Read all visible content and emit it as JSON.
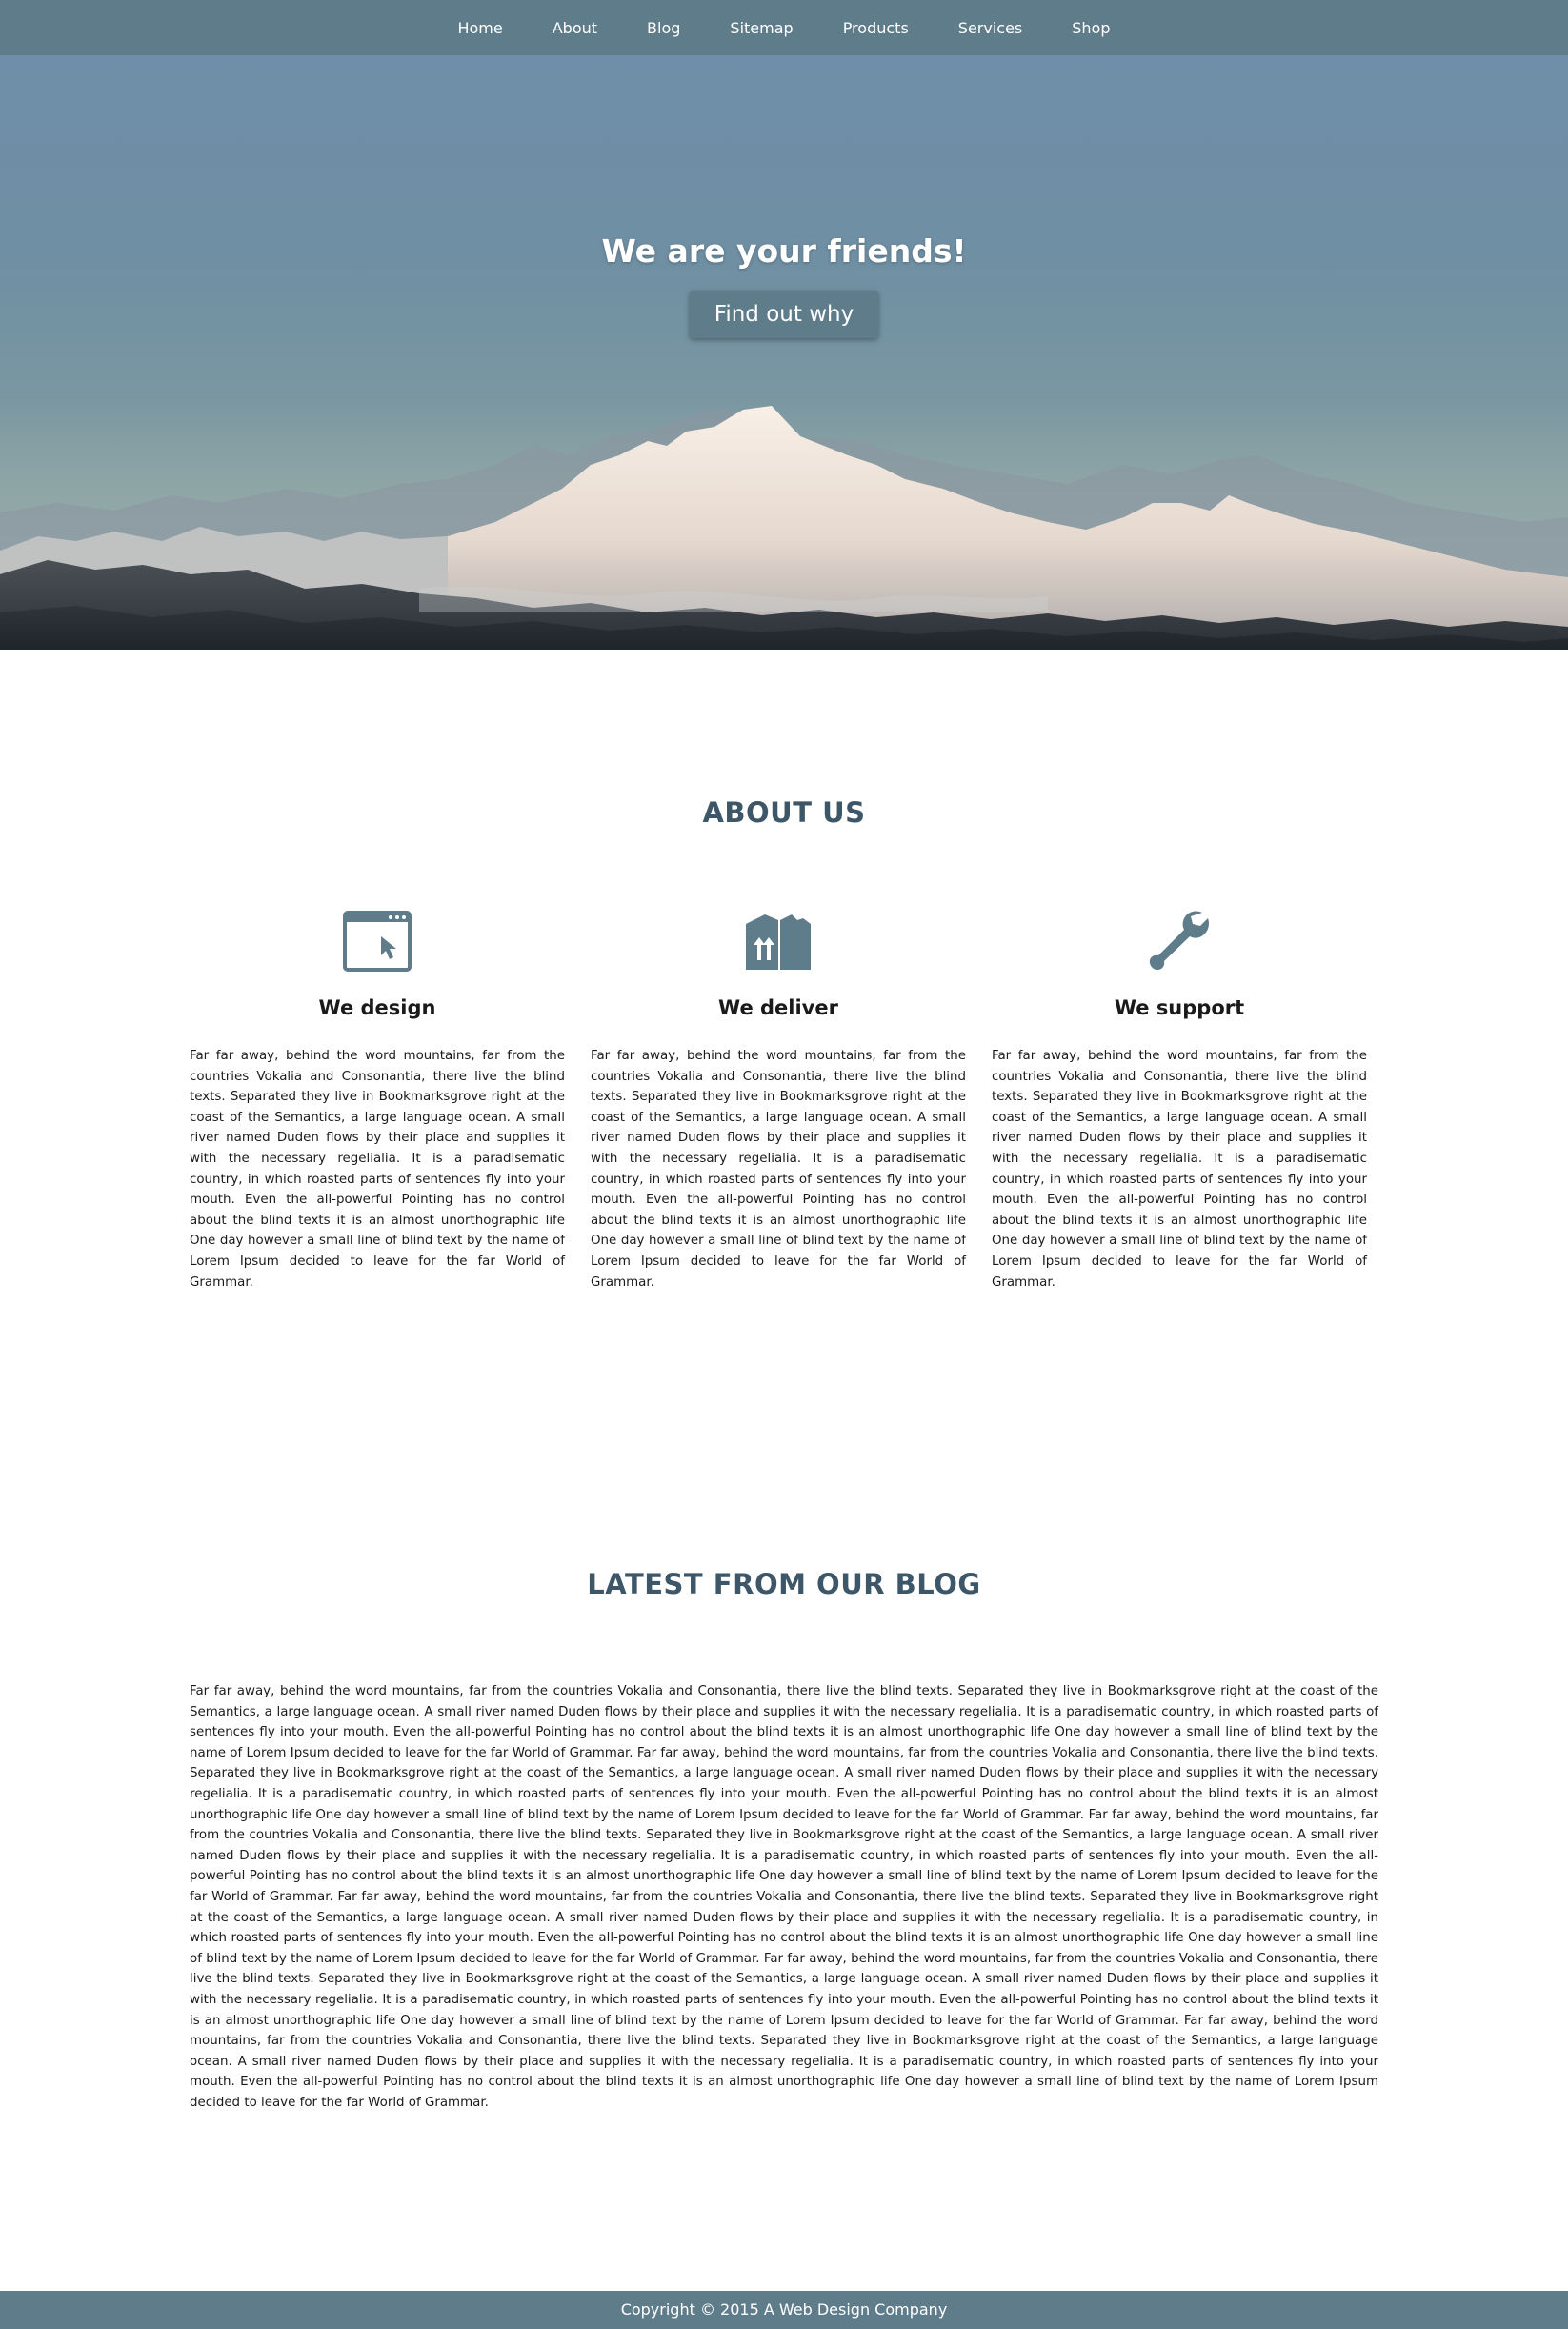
{
  "nav": {
    "items": [
      {
        "label": "Home"
      },
      {
        "label": "About"
      },
      {
        "label": "Blog"
      },
      {
        "label": "Sitemap"
      },
      {
        "label": "Products"
      },
      {
        "label": "Services"
      },
      {
        "label": "Shop"
      }
    ]
  },
  "hero": {
    "title": "We are your friends!",
    "button_label": "Find out why"
  },
  "about": {
    "title": "ABOUT US",
    "columns": [
      {
        "icon": "browser-window-cursor-icon",
        "heading": "We design",
        "text": "Far far away, behind the word mountains, far from the countries Vokalia and Consonantia, there live the blind texts. Separated they live in Bookmarksgrove right at the coast of the Semantics, a large language ocean. A small river named Duden flows by their place and supplies it with the necessary regelialia. It is a paradisematic country, in which roasted parts of sentences fly into your mouth. Even the all-powerful Pointing has no control about the blind texts it is an almost unorthographic life One day however a small line of blind text by the name of Lorem Ipsum decided to leave for the far World of Grammar."
      },
      {
        "icon": "package-box-icon",
        "heading": "We deliver",
        "text": "Far far away, behind the word mountains, far from the countries Vokalia and Consonantia, there live the blind texts. Separated they live in Bookmarksgrove right at the coast of the Semantics, a large language ocean. A small river named Duden flows by their place and supplies it with the necessary regelialia. It is a paradisematic country, in which roasted parts of sentences fly into your mouth. Even the all-powerful Pointing has no control about the blind texts it is an almost unorthographic life One day however a small line of blind text by the name of Lorem Ipsum decided to leave for the far World of Grammar."
      },
      {
        "icon": "wrench-icon",
        "heading": "We support",
        "text": "Far far away, behind the word mountains, far from the countries Vokalia and Consonantia, there live the blind texts. Separated they live in Bookmarksgrove right at the coast of the Semantics, a large language ocean. A small river named Duden flows by their place and supplies it with the necessary regelialia. It is a paradisematic country, in which roasted parts of sentences fly into your mouth. Even the all-powerful Pointing has no control about the blind texts it is an almost unorthographic life One day however a small line of blind text by the name of Lorem Ipsum decided to leave for the far World of Grammar."
      }
    ]
  },
  "blog": {
    "title": "LATEST FROM OUR BLOG",
    "text": "Far far away, behind the word mountains, far from the countries Vokalia and Consonantia, there live the blind texts. Separated they live in Bookmarksgrove right at the coast of the Semantics, a large language ocean. A small river named Duden flows by their place and supplies it with the necessary regelialia. It is a paradisematic country, in which roasted parts of sentences fly into your mouth. Even the all-powerful Pointing has no control about the blind texts it is an almost unorthographic life One day however a small line of blind text by the name of Lorem Ipsum decided to leave for the far World of Grammar. Far far away, behind the word mountains, far from the countries Vokalia and Consonantia, there live the blind texts. Separated they live in Bookmarksgrove right at the coast of the Semantics, a large language ocean. A small river named Duden flows by their place and supplies it with the necessary regelialia. It is a paradisematic country, in which roasted parts of sentences fly into your mouth. Even the all-powerful Pointing has no control about the blind texts it is an almost unorthographic life One day however a small line of blind text by the name of Lorem Ipsum decided to leave for the far World of Grammar. Far far away, behind the word mountains, far from the countries Vokalia and Consonantia, there live the blind texts. Separated they live in Bookmarksgrove right at the coast of the Semantics, a large language ocean. A small river named Duden flows by their place and supplies it with the necessary regelialia. It is a paradisematic country, in which roasted parts of sentences fly into your mouth. Even the all-powerful Pointing has no control about the blind texts it is an almost unorthographic life One day however a small line of blind text by the name of Lorem Ipsum decided to leave for the far World of Grammar. Far far away, behind the word mountains, far from the countries Vokalia and Consonantia, there live the blind texts. Separated they live in Bookmarksgrove right at the coast of the Semantics, a large language ocean. A small river named Duden flows by their place and supplies it with the necessary regelialia. It is a paradisematic country, in which roasted parts of sentences fly into your mouth. Even the all-powerful Pointing has no control about the blind texts it is an almost unorthographic life One day however a small line of blind text by the name of Lorem Ipsum decided to leave for the far World of Grammar. Far far away, behind the word mountains, far from the countries Vokalia and Consonantia, there live the blind texts. Separated they live in Bookmarksgrove right at the coast of the Semantics, a large language ocean. A small river named Duden flows by their place and supplies it with the necessary regelialia. It is a paradisematic country, in which roasted parts of sentences fly into your mouth. Even the all-powerful Pointing has no control about the blind texts it is an almost unorthographic life One day however a small line of blind text by the name of Lorem Ipsum decided to leave for the far World of Grammar. Far far away, behind the word mountains, far from the countries Vokalia and Consonantia, there live the blind texts. Separated they live in Bookmarksgrove right at the coast of the Semantics, a large language ocean. A small river named Duden flows by their place and supplies it with the necessary regelialia. It is a paradisematic country, in which roasted parts of sentences fly into your mouth. Even the all-powerful Pointing has no control about the blind texts it is an almost unorthographic life One day however a small line of blind text by the name of Lorem Ipsum decided to leave for the far World of Grammar."
  },
  "footer": {
    "copyright": "Copyright © 2015 A Web Design Company"
  },
  "colors": {
    "nav_bg": "#5f7c8b",
    "heading": "#3e5768",
    "icon": "#5f7c8b",
    "footer_bg": "#5f7c8b"
  }
}
